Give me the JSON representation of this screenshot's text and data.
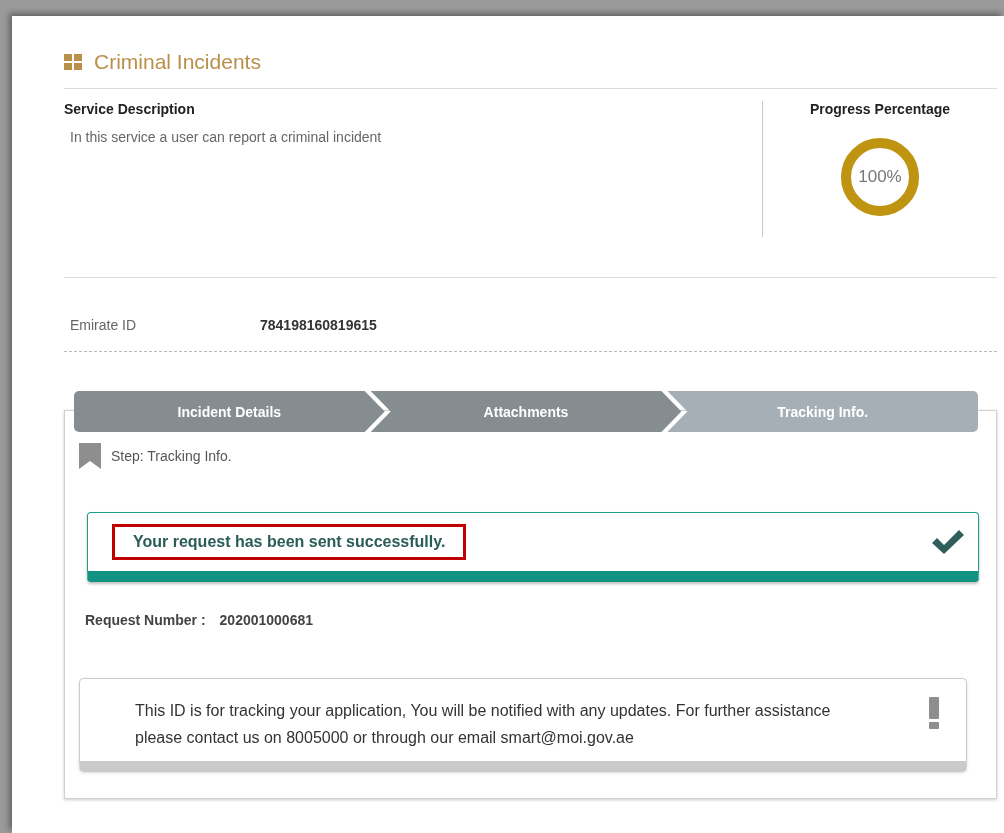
{
  "page": {
    "title": "Criminal Incidents"
  },
  "service": {
    "heading": "Service Description",
    "description": "In this service a user can report a criminal incident"
  },
  "progress": {
    "heading": "Progress Percentage",
    "level": 1,
    "reading": "100%"
  },
  "emirate_id": {
    "label": "Emirate ID",
    "value": "784198160819615"
  },
  "steps": [
    {
      "label": "Incident Details",
      "selected": false
    },
    {
      "label": "Attachments",
      "selected": false
    },
    {
      "label": "Tracking Info.",
      "selected": true
    }
  ],
  "current_step": "Step: Tracking Info.",
  "success": {
    "message": "Your request has been sent successfully.",
    "highlighted": true
  },
  "request_number": {
    "label": "Request Number :",
    "value": "202001000681"
  },
  "notice": {
    "text": "This ID is for tracking your application, You will be notified with any updates. For further assistance please contact us on 8005000 or through our email smart@moi.gov.ae"
  }
}
